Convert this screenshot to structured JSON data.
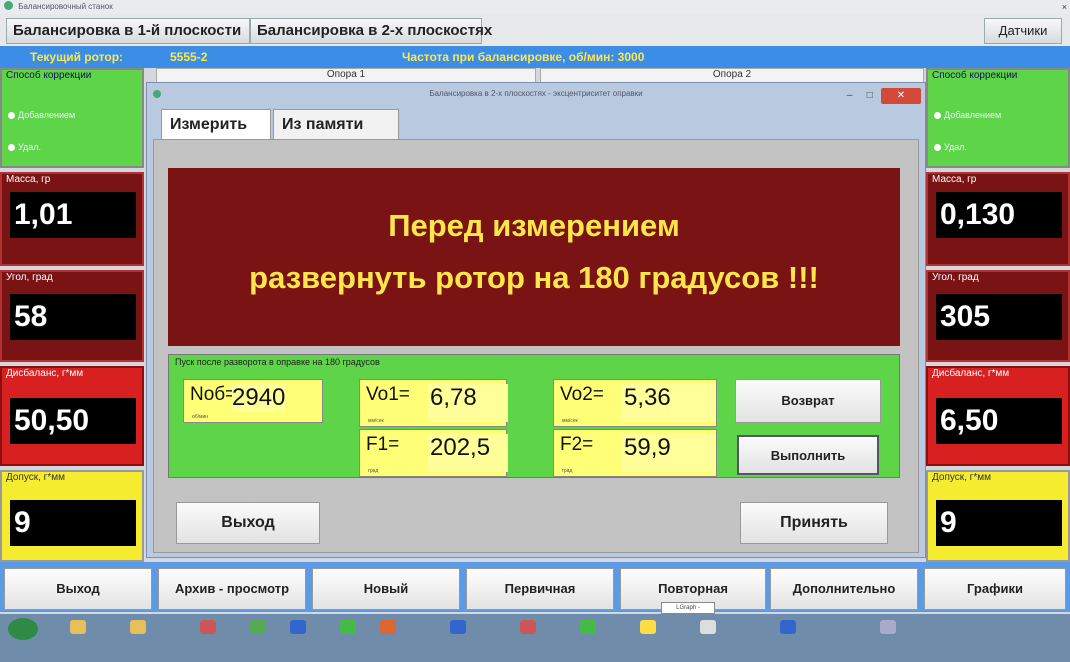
{
  "window": {
    "title": "Балансировочный станок",
    "close_glyph": "×"
  },
  "mode_tabs": [
    {
      "label": "Балансировка в 1-й плоскости"
    },
    {
      "label": "Балансировка в 2-х плоскостях"
    },
    {
      "label": "Датчики"
    }
  ],
  "info_bar": {
    "current_rotor_label": "Текущий ротор:",
    "current_rotor_value": "5555-2",
    "speed_text": "Частота при балансировке, об/мин: 3000"
  },
  "supports": {
    "support1": "Опора 1",
    "support2": "Опора 2"
  },
  "left_panel": {
    "method_label": "Способ коррекции",
    "method_options": [
      "Добавлением",
      "Удал."
    ],
    "mass_label": "Масса, гр",
    "mass_value": "1,01",
    "angle_label": "Угол, град",
    "angle_value": "58",
    "unbalance_label": "Дисбаланс, г*мм",
    "unbalance_value": "50,50",
    "tolerance_label": "Допуск, г*мм",
    "tolerance_value": "9"
  },
  "right_panel": {
    "method_label": "Способ коррекции",
    "method_options": [
      "Добавлением",
      "Удал."
    ],
    "mass_label": "Масса, гр",
    "mass_value": "0,130",
    "angle_label": "Угол, град",
    "angle_value": "305",
    "unbalance_label": "Дисбаланс, г*мм",
    "unbalance_value": "6,50",
    "tolerance_label": "Допуск, г*мм",
    "tolerance_value": "9"
  },
  "dialog": {
    "title": "Балансировка в 2-х плоскостях - эксцентриситет оправки",
    "btn_min": "–",
    "btn_max": "□",
    "btn_close": "✕",
    "tabs": [
      {
        "label": "Измерить"
      },
      {
        "label": "Из памяти"
      }
    ],
    "warning_line1": "Перед измерением",
    "warning_line2": "развернуть ротор на 180 градусов !!!",
    "launch_caption": "Пуск после разворота в оправке на 180 градусов",
    "fields": {
      "nob_label": "Nоб=",
      "nob_unit": "об/мин",
      "nob_value": "2940",
      "vo1_label": "Vo1=",
      "vo1_unit": "мм/сек",
      "vo1_value": "6,78",
      "f1_label": "F1=",
      "f1_unit": "град",
      "f1_value": "202,5",
      "vo2_label": "Vo2=",
      "vo2_unit": "мм/сек",
      "vo2_value": "5,36",
      "f2_label": "F2=",
      "f2_unit": "град",
      "f2_value": "59,9"
    },
    "btn_return": "Возврат",
    "btn_execute": "Выполнить",
    "btn_exit": "Выход",
    "btn_accept": "Принять"
  },
  "bottom_buttons": [
    {
      "label": "Выход"
    },
    {
      "label": "Архив - просмотр"
    },
    {
      "label": "Новый"
    },
    {
      "label": "Первичная"
    },
    {
      "label": "Повторная"
    },
    {
      "label": "Дополнительно"
    },
    {
      "label": "Графики"
    }
  ],
  "tooltip": "LGraph - Просмотр",
  "colors": {
    "info_bar_bg": "#3b8de6",
    "info_text": "#ffe64a",
    "panel_red_dark": "#7a1313",
    "panel_red": "#d82020",
    "panel_green": "#5ed449",
    "panel_yellow": "#f6ec2f",
    "field_yellow": "#ffff77",
    "bottom_bar": "#5a9be8"
  }
}
